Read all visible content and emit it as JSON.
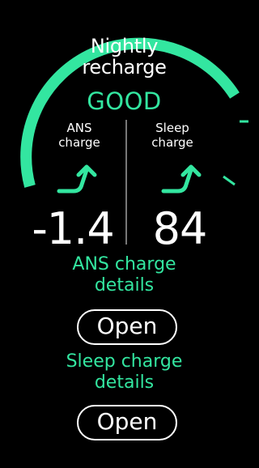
{
  "screen": {
    "title": "Nightly\nrecharge",
    "status": "GOOD",
    "accent_color": "#33e6a0",
    "gauge_icon": "recharge-gauge-arc"
  },
  "ans": {
    "label": "ANS\ncharge",
    "trend_icon": "trend-up-arrow-icon",
    "value": "-1.4",
    "details_label": "ANS charge\ndetails",
    "button_label": "Open"
  },
  "sleep": {
    "label": "Sleep\ncharge",
    "trend_icon": "trend-up-arrow-icon",
    "value": "84",
    "details_label": "Sleep charge\ndetails",
    "button_label": "Open"
  }
}
